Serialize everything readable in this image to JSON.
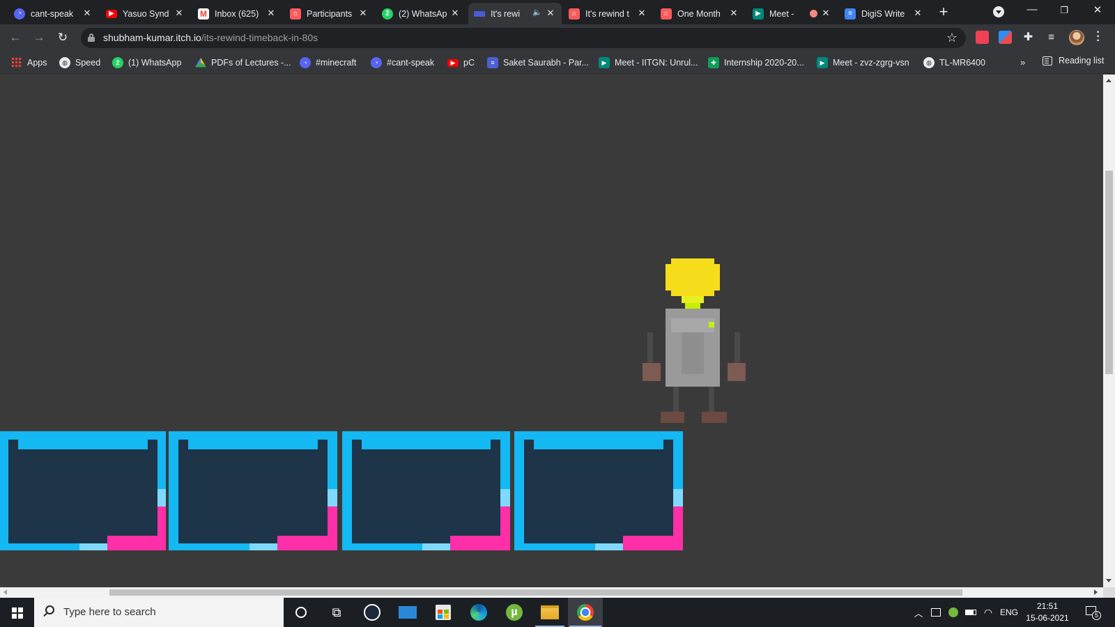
{
  "tabs": [
    {
      "title": "cant-speak",
      "icon": "discord-icon",
      "color": "#5865f2"
    },
    {
      "title": "Yasuo Synd",
      "icon": "youtube-icon",
      "color": "#ff0000"
    },
    {
      "title": "Inbox (625)",
      "icon": "gmail-icon",
      "color": "#ea4335"
    },
    {
      "title": "Participants",
      "icon": "itch-icon",
      "color": "#fa5c5c"
    },
    {
      "title": "(2) WhatsAp",
      "icon": "whatsapp-icon",
      "color": "#25d366"
    },
    {
      "title": "It's rewi",
      "icon": "game-icon",
      "color": "#6b7cff",
      "active": true,
      "audio": true
    },
    {
      "title": "It's rewind t",
      "icon": "itch-icon",
      "color": "#fa5c5c"
    },
    {
      "title": "One Month",
      "icon": "itch-icon",
      "color": "#fa5c5c"
    },
    {
      "title": "Meet -",
      "icon": "meet-icon",
      "color": "#00897b",
      "recording": true
    },
    {
      "title": "DigiS Write",
      "icon": "docs-icon",
      "color": "#4285f4"
    }
  ],
  "address": {
    "host": "shubham-kumar.itch.io",
    "path": "/its-rewind-timeback-in-80s"
  },
  "bookmarks": [
    {
      "label": "Apps",
      "icon": "apps-grid-icon"
    },
    {
      "label": "Speed",
      "icon": "globe-icon"
    },
    {
      "label": "(1) WhatsApp",
      "icon": "whatsapp-icon"
    },
    {
      "label": "PDFs of Lectures -...",
      "icon": "drive-icon"
    },
    {
      "label": "#minecraft",
      "icon": "discord-icon"
    },
    {
      "label": "#cant-speak",
      "icon": "discord-icon"
    },
    {
      "label": "pC",
      "icon": "youtube-icon"
    },
    {
      "label": "Saket Saurabh - Par...",
      "icon": "forms-icon"
    },
    {
      "label": "Meet - IITGN: Unrul...",
      "icon": "meet-icon"
    },
    {
      "label": "Internship 2020-20...",
      "icon": "sheets-icon"
    },
    {
      "label": "Meet - zvz-zgrg-vsn",
      "icon": "meet-icon"
    },
    {
      "label": "TL-MR6400",
      "icon": "globe-icon"
    }
  ],
  "reading_list": "Reading list",
  "more_bookmarks": "»",
  "taskbar": {
    "search_placeholder": "Type here to search",
    "language": "ENG",
    "time": "21:51",
    "date": "15-06-2021",
    "notifications": "5"
  },
  "colors": {
    "game_bg": "#3a3a3a",
    "platform_cyan": "#14b8f2",
    "platform_pink": "#ff2fa8",
    "platform_inner": "#1e3448",
    "bulb_yellow": "#f6dd1c"
  }
}
